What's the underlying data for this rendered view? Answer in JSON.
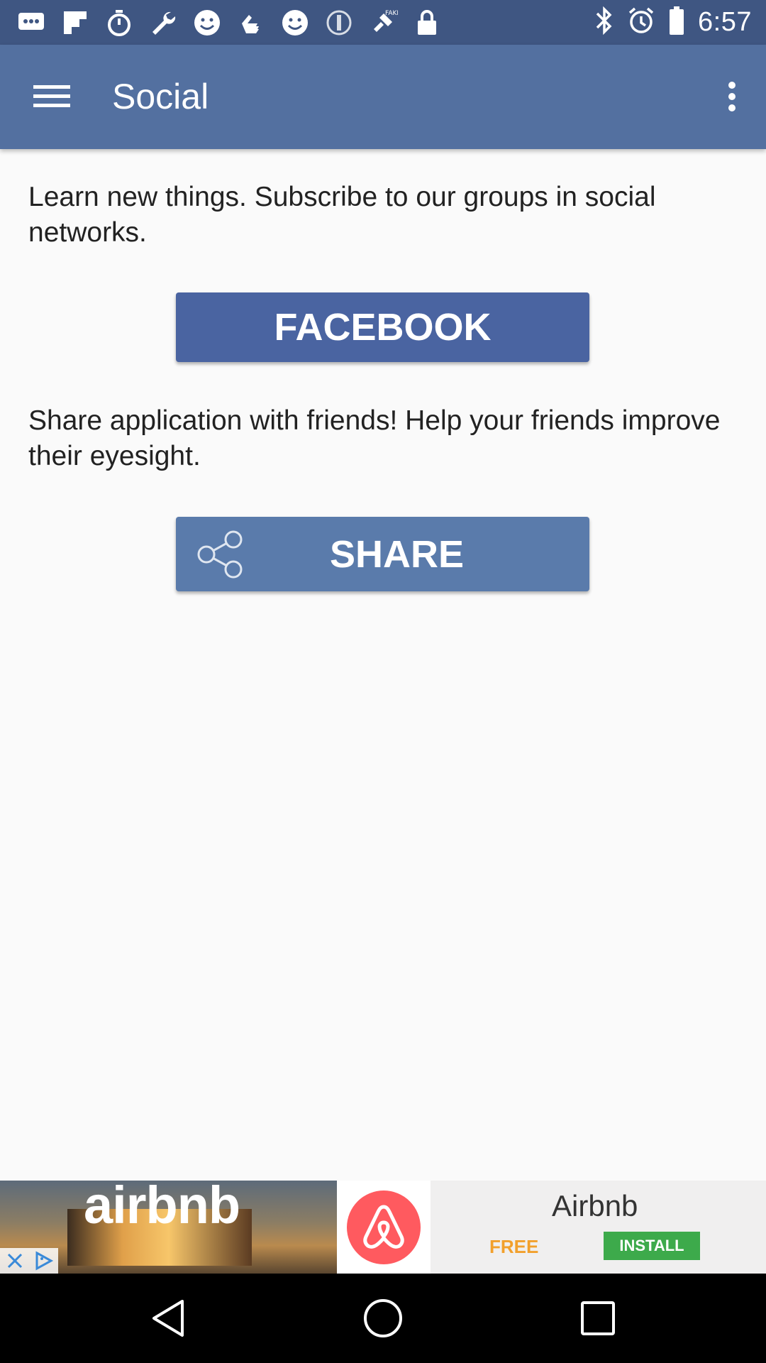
{
  "status_bar": {
    "time": "6:57",
    "left_icons": [
      "message-icon",
      "flipboard-icon",
      "stopwatch-icon",
      "wrench-icon",
      "smiley-icon",
      "hand-icon",
      "smiley-icon",
      "circle-icon",
      "fake-gps-icon",
      "lock-icon"
    ],
    "right_icons": [
      "bluetooth-icon",
      "alarm-icon",
      "battery-icon"
    ]
  },
  "toolbar": {
    "title": "Social",
    "background": "#5370a0"
  },
  "main": {
    "subscribe_text": "Learn new things. Subscribe to our groups in social networks.",
    "facebook_button": "FACEBOOK",
    "share_text": "Share application with friends! Help your friends improve their eyesight.",
    "share_button": "SHARE"
  },
  "ad": {
    "brand_text": "airbnb",
    "title": "Airbnb",
    "free_label": "FREE",
    "install_label": "INSTALL",
    "logo_color": "#ff5a5f"
  },
  "colors": {
    "status_bar": "#3f5682",
    "facebook": "#4a64a1",
    "share": "#5a7bab",
    "install": "#3daa4b"
  }
}
